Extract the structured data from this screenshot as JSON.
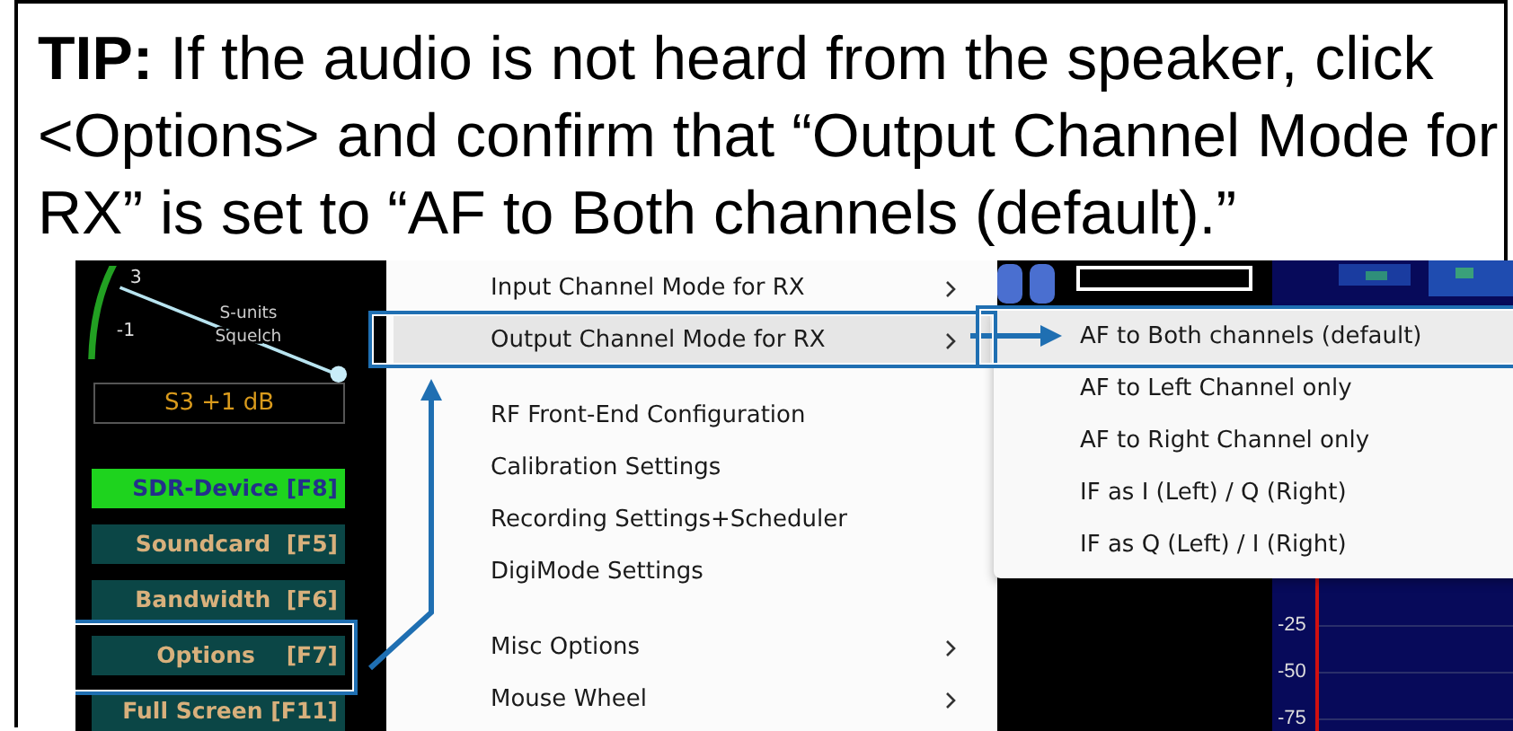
{
  "tip": "**TIP:** If the audio is not heard from the speaker, click <Options> and confirm that “Output Channel Mode for RX” is set to “AF to Both channels (default).”",
  "screenshot": {
    "meter": {
      "scale_labels": [
        "3",
        "-1"
      ],
      "title": "S-units",
      "subtitle": "Squelch",
      "reading": "S3 +1 dB"
    },
    "buttons": [
      {
        "label": "SDR-Device [F8]",
        "selected": true,
        "callout": false
      },
      {
        "label": "Soundcard  [F5]",
        "selected": false,
        "callout": false
      },
      {
        "label": "Bandwidth  [F6]",
        "selected": false,
        "callout": false
      },
      {
        "label": "Options    [F7]",
        "selected": false,
        "callout": true
      },
      {
        "label": "Full Screen [F11]",
        "selected": false,
        "callout": false
      }
    ],
    "menu": {
      "groups": [
        [
          {
            "label": "Input Channel Mode for RX",
            "submenu": true,
            "selected": false,
            "callout": false
          },
          {
            "label": "Output Channel Mode for RX",
            "submenu": true,
            "selected": true,
            "callout": true
          }
        ],
        [
          {
            "label": "RF Front-End Configuration",
            "submenu": false,
            "selected": false,
            "callout": false
          },
          {
            "label": "Calibration Settings",
            "submenu": false,
            "selected": false,
            "callout": false
          },
          {
            "label": "Recording Settings+Scheduler",
            "submenu": false,
            "selected": false,
            "callout": false
          },
          {
            "label": "DigiMode Settings",
            "submenu": false,
            "selected": false,
            "callout": false
          }
        ],
        [
          {
            "label": "Misc Options",
            "submenu": true,
            "selected": false,
            "callout": false
          },
          {
            "label": "Mouse Wheel",
            "submenu": true,
            "selected": false,
            "callout": false
          }
        ]
      ]
    },
    "submenu": {
      "items": [
        {
          "label": "AF to Both channels (default)",
          "selected": true,
          "callout": true
        },
        {
          "label": "AF to Left Channel only",
          "selected": false,
          "callout": false
        },
        {
          "label": "AF to Right Channel only",
          "selected": false,
          "callout": false
        },
        {
          "label": "IF as I (Left) / Q (Right)",
          "selected": false,
          "callout": false
        },
        {
          "label": "IF as Q (Left) / I (Right)",
          "selected": false,
          "callout": false
        }
      ]
    },
    "spectrum": {
      "scale_labels": [
        "-25",
        "-50",
        "-75"
      ]
    }
  }
}
